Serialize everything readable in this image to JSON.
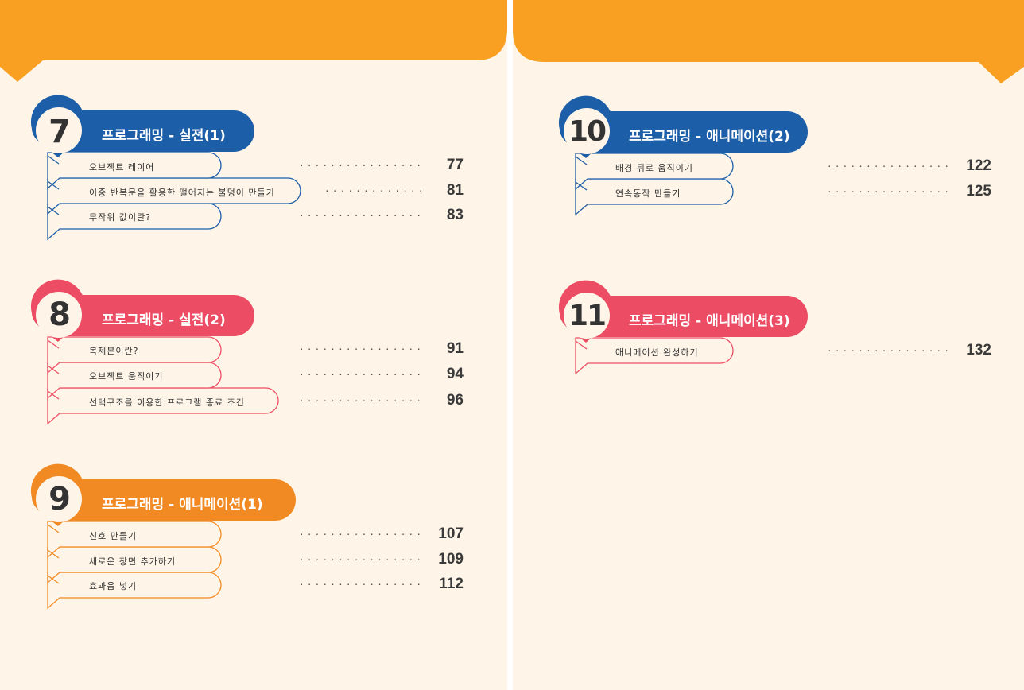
{
  "colors": {
    "page_background": "#fef5e8",
    "header_band": "#f9a023",
    "blue": "#1d5ea8",
    "red": "#ec4d64",
    "orange": "#f28a23"
  },
  "chapters": [
    {
      "number": "7",
      "title": "프로그래밍 - 실전(1)",
      "color": "#1d5ea8",
      "entries": [
        {
          "label": "오브젝트 레이어",
          "page": "77"
        },
        {
          "label": "이중 반복문을 활용한 떨어지는 불덩이 만들기",
          "page": "81"
        },
        {
          "label": "무작위 값이란?",
          "page": "83"
        }
      ]
    },
    {
      "number": "8",
      "title": "프로그래밍 - 실전(2)",
      "color": "#ec4d64",
      "entries": [
        {
          "label": "복제본이란?",
          "page": "91"
        },
        {
          "label": "오브젝트 움직이기",
          "page": "94"
        },
        {
          "label": "선택구조를 이용한 프로그램 종료 조건",
          "page": "96"
        }
      ]
    },
    {
      "number": "9",
      "title": "프로그래밍 - 애니메이션(1)",
      "color": "#f28a23",
      "entries": [
        {
          "label": "신호 만들기",
          "page": "107"
        },
        {
          "label": "새로운 장면 추가하기",
          "page": "109"
        },
        {
          "label": "효과음 넣기",
          "page": "112"
        }
      ]
    },
    {
      "number": "10",
      "title": "프로그래밍 - 애니메이션(2)",
      "color": "#1d5ea8",
      "entries": [
        {
          "label": "배경 뒤로 움직이기",
          "page": "122"
        },
        {
          "label": "연속동작 만들기",
          "page": "125"
        }
      ]
    },
    {
      "number": "11",
      "title": "프로그래밍 - 애니메이션(3)",
      "color": "#ec4d64",
      "entries": [
        {
          "label": "애니메이션 완성하기",
          "page": "132"
        }
      ]
    }
  ]
}
